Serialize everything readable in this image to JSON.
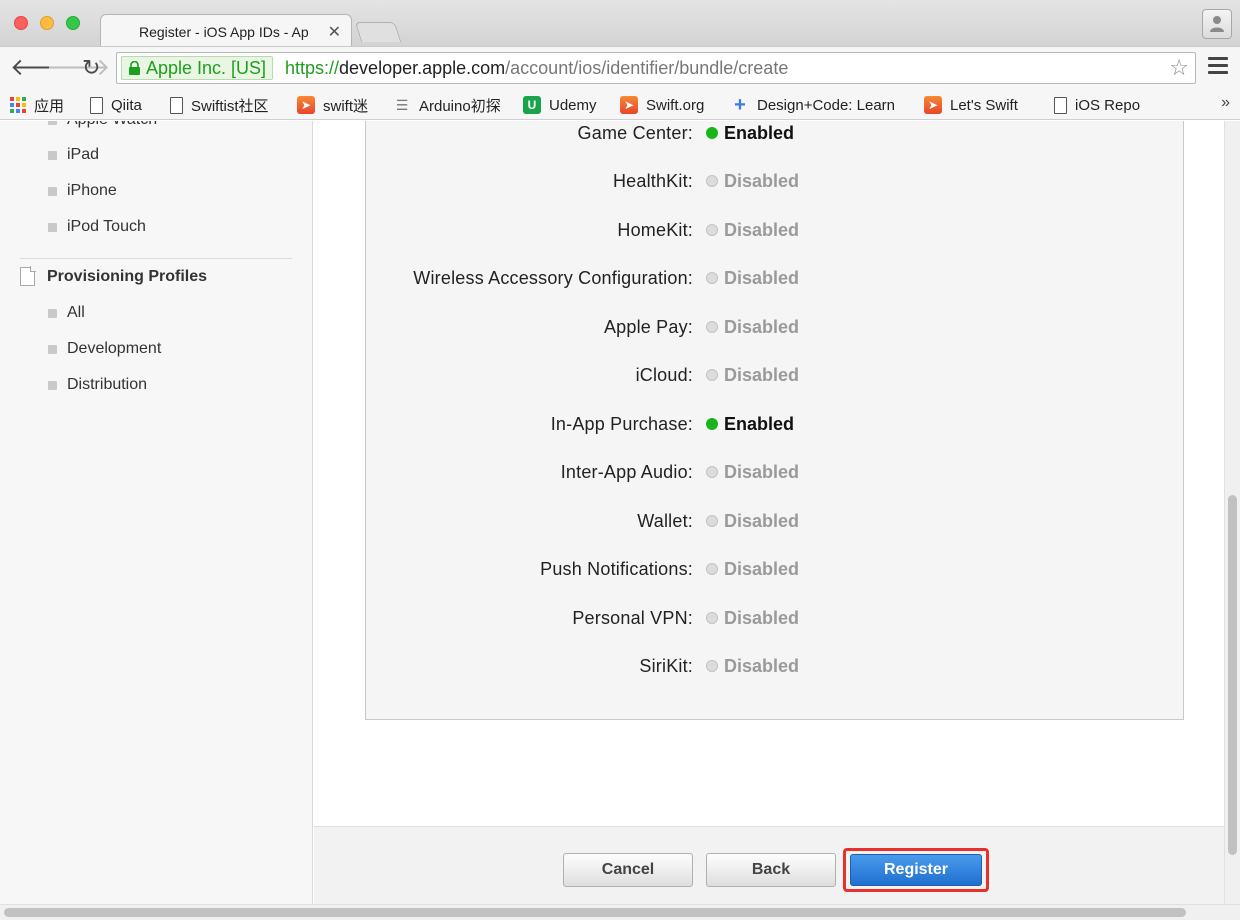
{
  "browser": {
    "tab": {
      "title": "Register - iOS App IDs - Ap",
      "favicon": "apple-icon"
    },
    "address": {
      "ev_label": "Apple Inc. [US]",
      "scheme": "https://",
      "host": "developer.apple.com",
      "path": "/account/ios/identifier/bundle/create"
    },
    "bookmarks": [
      {
        "label": "应用",
        "icon": "apps-grid-icon"
      },
      {
        "label": "Qiita",
        "icon": "page-icon"
      },
      {
        "label": "Swiftist社区",
        "icon": "page-icon"
      },
      {
        "label": "swift迷",
        "icon": "swift-icon"
      },
      {
        "label": "Arduino初探",
        "icon": "arduino-icon"
      },
      {
        "label": "Udemy",
        "icon": "udemy-icon"
      },
      {
        "label": "Swift.org",
        "icon": "swift-icon"
      },
      {
        "label": "Design+Code: Learn",
        "icon": "designcode-icon"
      },
      {
        "label": "Let's Swift",
        "icon": "swift-icon"
      },
      {
        "label": "iOS Repo",
        "icon": "page-icon"
      }
    ],
    "bookmarks_overflow": "»"
  },
  "sidebar": {
    "devices": [
      "Apple Watch",
      "iPad",
      "iPhone",
      "iPod Touch"
    ],
    "profiles_heading": "Provisioning Profiles",
    "profiles": [
      "All",
      "Development",
      "Distribution"
    ]
  },
  "services": [
    {
      "label": "Game Center:",
      "status": "Enabled",
      "enabled": true
    },
    {
      "label": "HealthKit:",
      "status": "Disabled",
      "enabled": false
    },
    {
      "label": "HomeKit:",
      "status": "Disabled",
      "enabled": false
    },
    {
      "label": "Wireless Accessory Configuration:",
      "status": "Disabled",
      "enabled": false
    },
    {
      "label": "Apple Pay:",
      "status": "Disabled",
      "enabled": false
    },
    {
      "label": "iCloud:",
      "status": "Disabled",
      "enabled": false
    },
    {
      "label": "In-App Purchase:",
      "status": "Enabled",
      "enabled": true
    },
    {
      "label": "Inter-App Audio:",
      "status": "Disabled",
      "enabled": false
    },
    {
      "label": "Wallet:",
      "status": "Disabled",
      "enabled": false
    },
    {
      "label": "Push Notifications:",
      "status": "Disabled",
      "enabled": false
    },
    {
      "label": "Personal VPN:",
      "status": "Disabled",
      "enabled": false
    },
    {
      "label": "SiriKit:",
      "status": "Disabled",
      "enabled": false
    }
  ],
  "actions": {
    "cancel": "Cancel",
    "back": "Back",
    "register": "Register"
  },
  "colors": {
    "enabled": "#19b419",
    "disabled": "#dcdcdc",
    "register": "#1f6fd0",
    "highlight": "#e8302a"
  }
}
